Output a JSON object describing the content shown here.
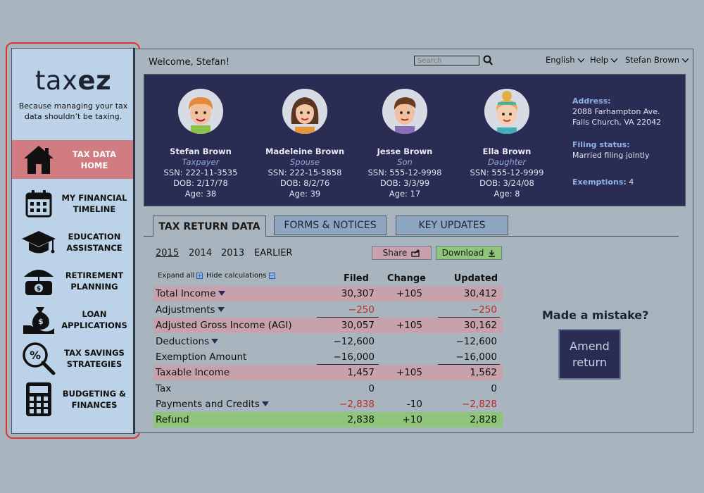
{
  "app": {
    "logo_light": "tax",
    "logo_bold": "ez",
    "tagline": "Because managing your tax data shouldn’t be taxing."
  },
  "sidebar": {
    "items": [
      {
        "label": "TAX DATA HOME",
        "icon": "house-icon",
        "active": true
      },
      {
        "label": "MY FINANCIAL TIMELINE",
        "icon": "calendar-icon",
        "active": false
      },
      {
        "label": "EDUCATION ASSISTANCE",
        "icon": "graduation-cap-icon",
        "active": false
      },
      {
        "label": "RETIREMENT PLANNING",
        "icon": "nest-egg-umbrella-icon",
        "active": false
      },
      {
        "label": "LOAN APPLICATIONS",
        "icon": "money-bag-hand-icon",
        "active": false
      },
      {
        "label": "TAX SAVINGS STRATEGIES",
        "icon": "percent-magnifier-icon",
        "active": false
      },
      {
        "label": "BUDGETING & FINANCES",
        "icon": "calculator-icon",
        "active": false
      }
    ]
  },
  "header": {
    "welcome": "Welcome, Stefan!",
    "search_placeholder": "Search",
    "language": "English",
    "help": "Help",
    "user": "Stefan Brown"
  },
  "family": {
    "members": [
      {
        "name": "Stefan Brown",
        "role": "Taxpayer",
        "ssn": "SSN: 222-11-3535",
        "dob": "DOB: 2/17/78",
        "age": "Age: 38"
      },
      {
        "name": "Madeleine Brown",
        "role": "Spouse",
        "ssn": "SSN: 222-15-5858",
        "dob": "DOB: 8/2/76",
        "age": "Age: 39"
      },
      {
        "name": "Jesse Brown",
        "role": "Son",
        "ssn": "SSN: 555-12-9998",
        "dob": "DOB: 3/3/99",
        "age": "Age: 17"
      },
      {
        "name": "Ella Brown",
        "role": "Daughter",
        "ssn": "SSN: 555-12-9999",
        "dob": "DOB: 3/24/08",
        "age": "Age: 8"
      }
    ],
    "address_label": "Address:",
    "address_line1": "2088 Farhampton Ave.",
    "address_line2": "Falls Church, VA 22042",
    "filing_label": "Filing status:",
    "filing_value": "Married filing jointly",
    "exemptions_label": "Exemptions:",
    "exemptions_value": "4"
  },
  "tabs": [
    {
      "label": "TAX RETURN DATA",
      "active": true
    },
    {
      "label": "FORMS & NOTICES",
      "active": false
    },
    {
      "label": "KEY UPDATES",
      "active": false
    }
  ],
  "years": [
    "2015",
    "2014",
    "2013",
    "EARLIER"
  ],
  "actions": {
    "share": "Share",
    "download": "Download"
  },
  "toggles": {
    "expand_all": "Expand all",
    "hide_calc": "Hide calculations"
  },
  "table": {
    "headers": {
      "filed": "Filed",
      "change": "Change",
      "updated": "Updated"
    },
    "rows": [
      {
        "label": "Total Income",
        "caret": true,
        "style": "pink",
        "filed": "30,307",
        "change": "+105",
        "updated": "30,412"
      },
      {
        "label": "Adjustments",
        "caret": true,
        "style": "none",
        "filed": "−250",
        "change": "",
        "updated": "−250"
      },
      {
        "label": "Adjusted Gross Income (AGI)",
        "caret": false,
        "style": "pink",
        "filed": "30,057",
        "change": "+105",
        "updated": "30,162"
      },
      {
        "label": "Deductions",
        "caret": true,
        "style": "none",
        "filed": "−12,600",
        "change": "",
        "updated": "−12,600"
      },
      {
        "label": "Exemption Amount",
        "caret": false,
        "style": "none",
        "filed": "−16,000",
        "change": "",
        "updated": "−16,000"
      },
      {
        "label": "Taxable Income",
        "caret": false,
        "style": "pink",
        "filed": "1,457",
        "change": "+105",
        "updated": "1,562"
      },
      {
        "label": "Tax",
        "caret": false,
        "style": "none",
        "filed": "0",
        "change": "",
        "updated": "0"
      },
      {
        "label": "Payments and Credits",
        "caret": true,
        "style": "none",
        "filed": "−2,838",
        "change": "-10",
        "updated": "−2,828"
      },
      {
        "label": "Refund",
        "caret": false,
        "style": "green",
        "filed": "2,838",
        "change": "+10",
        "updated": "2,828"
      }
    ]
  },
  "mistake": {
    "prompt": "Made a mistake?",
    "amend": "Amend return"
  },
  "colors": {
    "accent_pink": "#c7a2ad",
    "refund_green": "#8fc57a",
    "banner_navy": "#2b2c54",
    "nav_active": "#d07c80"
  }
}
